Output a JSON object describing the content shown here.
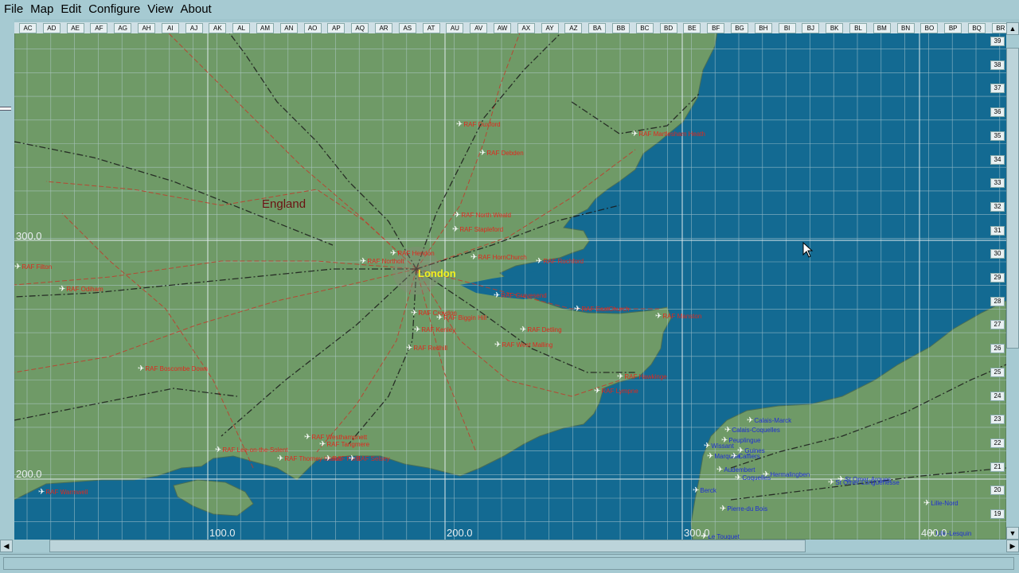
{
  "menu": [
    "File",
    "Map",
    "Edit",
    "Configure",
    "View",
    "About"
  ],
  "columns": [
    "AC",
    "AD",
    "AE",
    "AF",
    "AG",
    "AH",
    "AI",
    "AJ",
    "AK",
    "AL",
    "AM",
    "AN",
    "AO",
    "AP",
    "AQ",
    "AR",
    "AS",
    "AT",
    "AU",
    "AV",
    "AW",
    "AX",
    "AY",
    "AZ",
    "BA",
    "BB",
    "BC",
    "BD",
    "BE",
    "BF",
    "BG",
    "BH",
    "BI",
    "BJ",
    "BK",
    "BL",
    "BM",
    "BN",
    "BO",
    "BP",
    "BQ",
    "BR"
  ],
  "rows": [
    "39",
    "38",
    "37",
    "36",
    "35",
    "34",
    "33",
    "32",
    "31",
    "30",
    "29",
    "28",
    "27",
    "26",
    "25",
    "24",
    "23",
    "22",
    "21",
    "20",
    "19"
  ],
  "axis": {
    "x": [
      "100.0",
      "200.0",
      "300.0",
      "400.0"
    ],
    "y": [
      "300.0",
      "200.0"
    ]
  },
  "regions": {
    "england": "England",
    "london": "London"
  },
  "colors": {
    "sea": "#136a92",
    "land": "#6f9a67",
    "uk_airfield": "#e0281e",
    "fr_airfield": "#1f2fd4",
    "grid": "#b8cfd6",
    "rail": "#1a1a1a",
    "road": "#c23a2a"
  },
  "uk_airfields": [
    "RAF Duxford",
    "RAF Debden",
    "RAF Martlesham Heath",
    "RAF North Weald",
    "RAF Stapleford",
    "RAF Hendon",
    "RAF Northolt",
    "RAF HornChurch",
    "RAF Rochford",
    "RAF Odiham",
    "RAF Filton",
    "RAF Gravesend",
    "RAF Croydon",
    "RAF Biggin Hill",
    "RAF Kenley",
    "RAF Detling",
    "RAF Redhill",
    "RAF West Malling",
    "RAF EastChurch",
    "RAF Manston",
    "RAF Hawkinge",
    "RAF Lympne",
    "RAF Boscombe Down",
    "RAF Westhampnett",
    "RAF Tangmere",
    "RAF Lee-on-the-Solent",
    "RAF Thorney Island",
    "RAF Ford",
    "RAF Selsey",
    "RAF Warmwell"
  ],
  "fr_airfields": [
    "Calais-Marck",
    "Calais-Coquelles",
    "Wissant",
    "Peuplingue",
    "Marquise",
    "Caffiers",
    "Guines",
    "Audembert",
    "Hermalingben",
    "Coquelles",
    "St Omer-Arques",
    "St Omer-Longuenesse",
    "Berck",
    "Pierre-du Bois",
    "Le Touquet",
    "Lille-Nord",
    "Lille-Lesquin"
  ],
  "status": {
    "text": ""
  }
}
